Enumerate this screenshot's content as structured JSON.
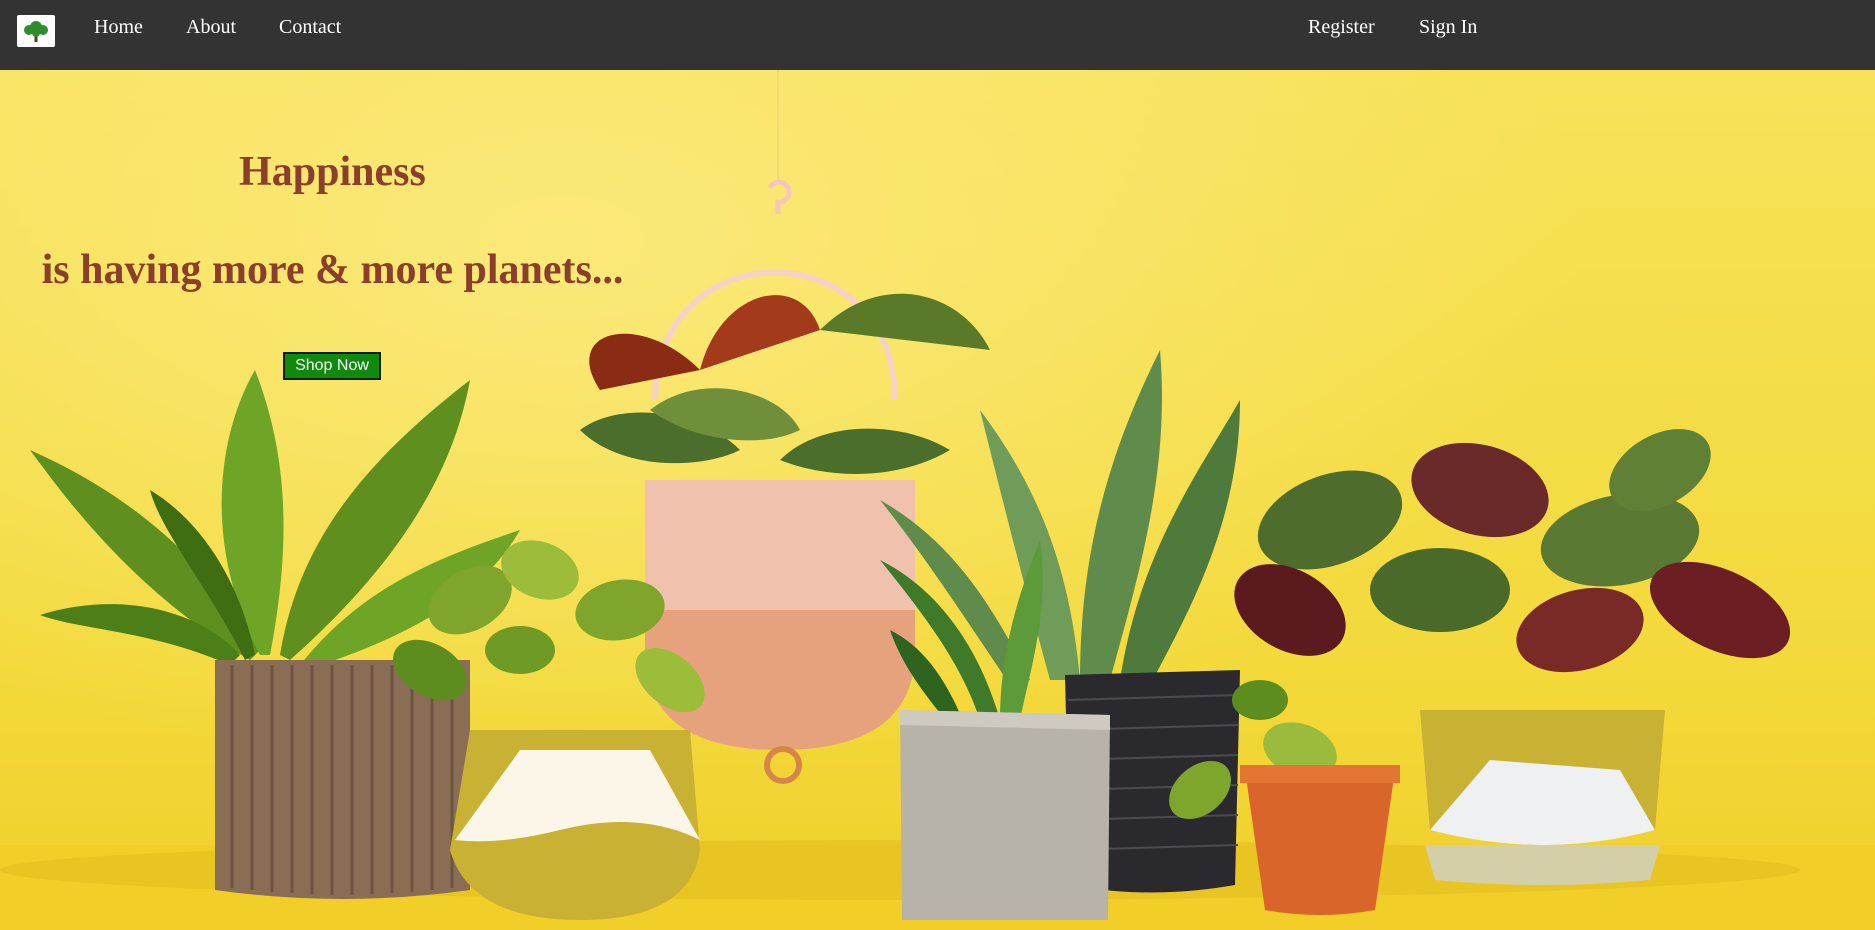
{
  "nav": {
    "logo_icon": "tree-icon",
    "links": {
      "home": "Home",
      "about": "About",
      "contact": "Contact"
    },
    "auth": {
      "register": "Register",
      "sign_in": "Sign In"
    }
  },
  "hero": {
    "title": "Happiness",
    "subtitle": "is having more & more planets...",
    "cta": "Shop Now"
  },
  "colors": {
    "nav_bg": "#333333",
    "hero_bg": "#f2dc3a",
    "heading": "#8b3f2b",
    "button_bg": "#0f8a0f"
  }
}
